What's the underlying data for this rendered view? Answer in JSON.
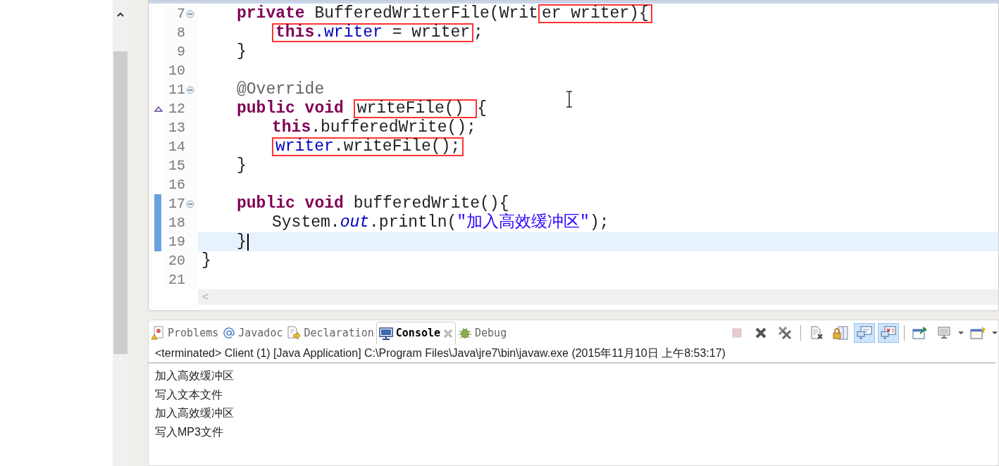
{
  "editor": {
    "lines": [
      {
        "kind": "block",
        "children": [
          {
            "number": "7",
            "fold": true,
            "override": false,
            "changed": false,
            "current": false,
            "caret": false,
            "tokens": [
              {
                "kind": "keyword",
                "text": "private "
              },
              {
                "kind": "plain",
                "text": "BufferedWriterFile(Writ"
              },
              {
                "kind": "highlight",
                "tokens": [
                  {
                    "kind": "plain",
                    "text": "er writer){"
                  }
                ]
              }
            ],
            "children": [
              {
                "number": "8",
                "fold": false,
                "override": false,
                "changed": false,
                "current": false,
                "caret": false,
                "tokens": [
                  {
                    "kind": "highlight",
                    "tokens": [
                      {
                        "kind": "keyword",
                        "text": "this"
                      },
                      {
                        "kind": "field",
                        "text": ".writer"
                      },
                      {
                        "kind": "plain",
                        "text": " = writer"
                      }
                    ]
                  },
                  {
                    "kind": "plain",
                    "text": ";"
                  }
                ]
              }
            ]
          },
          {
            "number": "9",
            "fold": false,
            "override": false,
            "changed": false,
            "current": false,
            "caret": false,
            "tokens": [
              {
                "kind": "plain",
                "text": "}"
              }
            ]
          },
          {
            "number": "10",
            "fold": false,
            "override": false,
            "changed": false,
            "current": false,
            "caret": false
          },
          {
            "number": "11",
            "fold": true,
            "override": false,
            "changed": false,
            "current": false,
            "caret": false,
            "tokens": [
              {
                "kind": "annotation",
                "text": "@Override"
              }
            ]
          },
          {
            "number": "12",
            "fold": false,
            "override": true,
            "changed": false,
            "current": false,
            "caret": false,
            "tokens": [
              {
                "kind": "keyword",
                "text": "public void "
              },
              {
                "kind": "highlight",
                "tokens": [
                  {
                    "kind": "plain",
                    "text": "writeFile() "
                  }
                ]
              },
              {
                "kind": "plain",
                "text": "{"
              }
            ],
            "children": [
              {
                "number": "13",
                "fold": false,
                "override": false,
                "changed": false,
                "current": false,
                "caret": false,
                "tokens": [
                  {
                    "kind": "keyword",
                    "text": "this"
                  },
                  {
                    "kind": "plain",
                    "text": ".bufferedWrite();"
                  }
                ]
              },
              {
                "number": "14",
                "fold": false,
                "override": false,
                "changed": false,
                "current": false,
                "caret": false,
                "tokens": [
                  {
                    "kind": "highlight",
                    "tokens": [
                      {
                        "kind": "field",
                        "text": "writer"
                      },
                      {
                        "kind": "plain",
                        "text": ".writeFile();"
                      }
                    ]
                  }
                ]
              }
            ]
          },
          {
            "number": "15",
            "fold": false,
            "override": false,
            "changed": false,
            "current": false,
            "caret": false,
            "tokens": [
              {
                "kind": "plain",
                "text": "}"
              }
            ]
          },
          {
            "number": "16",
            "fold": false,
            "override": false,
            "changed": false,
            "current": false,
            "caret": false
          },
          {
            "number": "17",
            "fold": true,
            "override": false,
            "changed": true,
            "current": false,
            "caret": false,
            "tokens": [
              {
                "kind": "keyword",
                "text": "public void "
              },
              {
                "kind": "plain",
                "text": "bufferedWrite(){"
              }
            ],
            "children": [
              {
                "number": "18",
                "fold": false,
                "override": false,
                "changed": true,
                "current": false,
                "caret": false,
                "tokens": [
                  {
                    "kind": "plain",
                    "text": "System."
                  },
                  {
                    "kind": "static",
                    "text": "out"
                  },
                  {
                    "kind": "plain",
                    "text": ".println("
                  },
                  {
                    "kind": "string",
                    "text": "\"加入高效缓冲区\""
                  },
                  {
                    "kind": "plain",
                    "text": ");"
                  }
                ]
              }
            ]
          },
          {
            "number": "19",
            "fold": false,
            "override": false,
            "changed": true,
            "current": true,
            "caret": true,
            "tokens": [
              {
                "kind": "plain",
                "text": "}"
              }
            ]
          }
        ]
      },
      {
        "number": "20",
        "fold": false,
        "override": false,
        "changed": false,
        "current": false,
        "caret": false,
        "tokens": [
          {
            "kind": "plain",
            "text": "}"
          }
        ]
      },
      {
        "number": "21",
        "fold": false,
        "override": false,
        "changed": false,
        "current": false,
        "caret": false
      }
    ],
    "scroll_left": "<"
  },
  "console": {
    "tabs": [
      {
        "kind": "problems",
        "label": "Problems",
        "selected": false
      },
      {
        "kind": "javadoc",
        "label": "Javadoc",
        "selected": false
      },
      {
        "kind": "declaration",
        "label": "Declaration",
        "selected": false
      },
      {
        "kind": "console",
        "label": "Console",
        "selected": true
      },
      {
        "kind": "debug",
        "label": "Debug",
        "selected": false
      }
    ],
    "toolbar": [
      {
        "kind": "terminate",
        "selected": false,
        "disabled": true
      },
      {
        "kind": "remove",
        "selected": false,
        "disabled": false
      },
      {
        "kind": "remove-all",
        "selected": false,
        "disabled": false
      },
      {
        "kind": "separator"
      },
      {
        "kind": "clear",
        "selected": false,
        "disabled": false
      },
      {
        "kind": "scroll-lock",
        "selected": false,
        "disabled": false
      },
      {
        "kind": "show-on-out",
        "selected": true,
        "disabled": false
      },
      {
        "kind": "show-on-err",
        "selected": true,
        "disabled": false
      },
      {
        "kind": "separator"
      },
      {
        "kind": "pin",
        "selected": false,
        "disabled": false
      },
      {
        "kind": "display",
        "selected": false,
        "disabled": false
      },
      {
        "kind": "dropdown"
      },
      {
        "kind": "open",
        "selected": false,
        "disabled": false
      },
      {
        "kind": "dropdown"
      }
    ],
    "status": "<terminated> Client (1) [Java Application] C:\\Program Files\\Java\\jre7\\bin\\javaw.exe (2015年11月10日 上午8:53:17)",
    "output": [
      "加入高效缓冲区",
      "写入文本文件",
      "加入高效缓冲区",
      "写入MP3文件"
    ]
  }
}
